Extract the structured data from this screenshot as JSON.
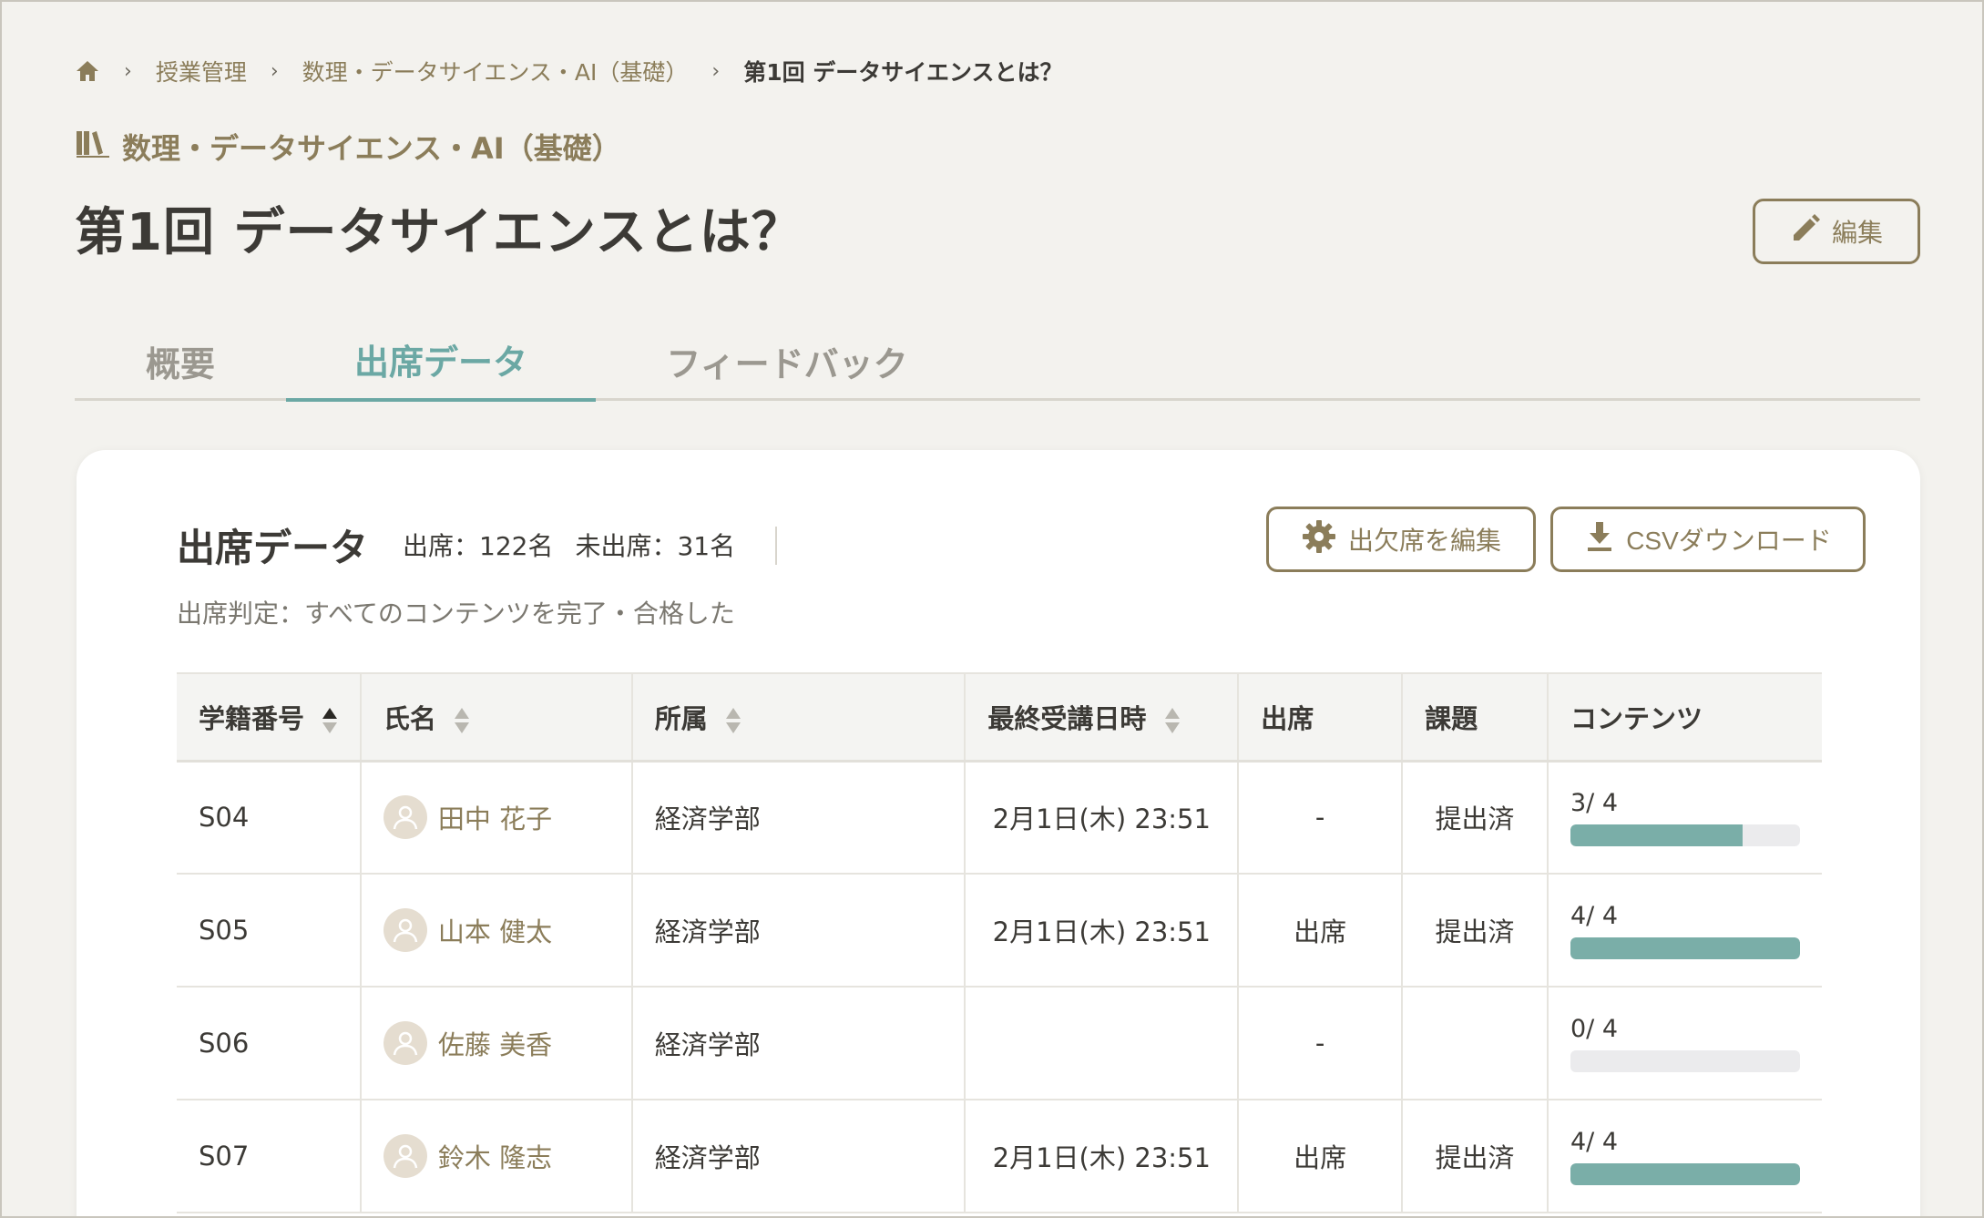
{
  "breadcrumb": {
    "items": [
      "授業管理",
      "数理・データサイエンス・AI（基礎）"
    ],
    "current": "第1回 データサイエンスとは？",
    "separator": "›"
  },
  "course": {
    "title": "数理・データサイエンス・AI（基礎）"
  },
  "page_title": "第1回 データサイエンスとは？",
  "edit_label": "編集",
  "tabs": [
    {
      "label": "概要",
      "active": false
    },
    {
      "label": "出席データ",
      "active": true
    },
    {
      "label": "フィードバック",
      "active": false
    }
  ],
  "attendance": {
    "title": "出席データ",
    "present": "出席：122名",
    "absent": "未出席：31名",
    "judgement": "出席判定：すべてのコンテンツを完了・合格した",
    "edit_attendance_label": "出欠席を編集",
    "csv_label": "CSVダウンロード"
  },
  "table": {
    "headers": [
      "学籍番号",
      "氏名",
      "所属",
      "最終受講日時",
      "出席",
      "課題",
      "コンテンツ"
    ],
    "rows": [
      {
        "id": "S04",
        "name": "田中 花子",
        "dept": "経済学部",
        "last": "2月1日(木) 23:51",
        "attend": "-",
        "task": "提出済",
        "content": "3/ 4",
        "progress": 0.75
      },
      {
        "id": "S05",
        "name": "山本 健太",
        "dept": "経済学部",
        "last": "2月1日(木) 23:51",
        "attend": "出席",
        "task": "提出済",
        "content": "4/ 4",
        "progress": 1.0
      },
      {
        "id": "S06",
        "name": "佐藤 美香",
        "dept": "経済学部",
        "last": "",
        "attend": "-",
        "task": "",
        "content": "0/ 4",
        "progress": 0.0
      },
      {
        "id": "S07",
        "name": "鈴木 隆志",
        "dept": "経済学部",
        "last": "2月1日(木) 23:51",
        "attend": "出席",
        "task": "提出済",
        "content": "4/ 4",
        "progress": 1.0
      }
    ]
  },
  "colors": {
    "accent": "#8b7d5a",
    "teal": "#6ba8a4",
    "progress": "#7aaea8"
  },
  "icons": [
    "home-icon",
    "book-icon",
    "pencil-icon",
    "gear-icon",
    "download-icon",
    "sort-icon",
    "avatar-icon"
  ]
}
